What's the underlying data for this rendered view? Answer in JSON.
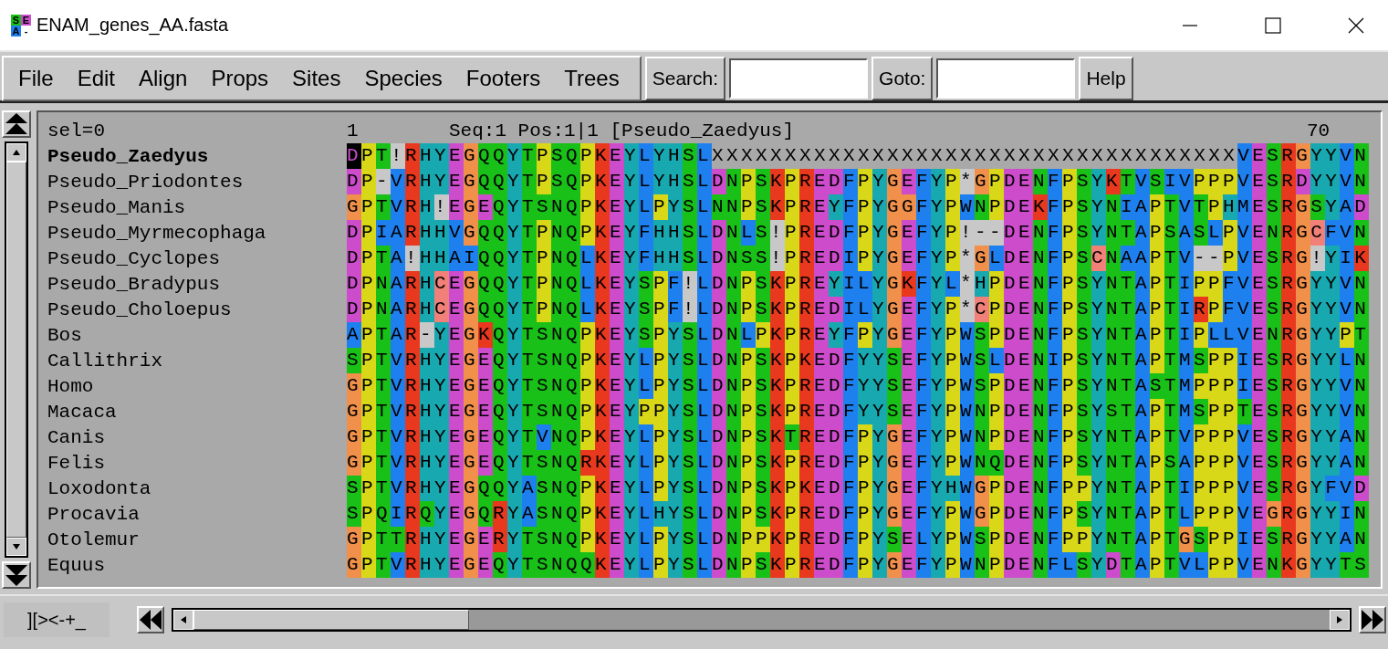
{
  "window": {
    "title": "ENAM_genes_AA.fasta",
    "icon_letters": [
      "S",
      "E",
      "A",
      "-"
    ]
  },
  "menu": [
    "File",
    "Edit",
    "Align",
    "Props",
    "Sites",
    "Species",
    "Footers",
    "Trees"
  ],
  "toolbar": {
    "search_button": "Search:",
    "goto_button": "Goto:",
    "help_button": "Help"
  },
  "alignment": {
    "selection": "sel=0",
    "start": "1",
    "status": "Seq:1 Pos:1|1 [Pseudo_Zaedyus]",
    "end": "70",
    "rows": [
      {
        "name": "Pseudo_Zaedyus",
        "current": true,
        "sequence": "DPT!RHYEGQQYTPSQPKEYLYHSLXXXXXXXXXXXXXXXXXXXXXXXXXXXXXXXXXXXXVESRGYYVN"
      },
      {
        "name": "Pseudo_Priodontes",
        "current": false,
        "sequence": "DP-VRHYEGQQYTPSQPKEYLYHSLDNPSKPREDFPYGEFYP*GPDENFPSYKTVSIVPPPVESRDYYVN"
      },
      {
        "name": "Pseudo_Manis",
        "current": false,
        "sequence": "GPTVRH!EGEQYTSNQPKEYLPYSLNNPSKPREYFPYGGFYPWNPDEKFPSYNIAPTVTPHMESRGSYAD"
      },
      {
        "name": "Pseudo_Myrmecophaga",
        "current": false,
        "sequence": "DPIARHHVGQQYTPNQPKEYFHHSLDNLS!PREDFPYGEFYP!--DENFPSYNTAPSASLPVENRGCFVN"
      },
      {
        "name": "Pseudo_Cyclopes",
        "current": false,
        "sequence": "DPTA!HHAIQQYTPNQLKEYFHHSLDNSS!PREDIPYGEFYP*GLDENFPSCNAAPTV--PVESRG!YIK"
      },
      {
        "name": "Pseudo_Bradypus",
        "current": false,
        "sequence": "DPNARHCEGQQYTPNQLKEYSPF!LDNPSKPREYILYGKFYL*HPDENFPSYNTAPTIPPFVESRGYYVN"
      },
      {
        "name": "Pseudo_Choloepus",
        "current": false,
        "sequence": "DPNARHCEGQQYTPNQLKEYSPF!LDNPSKPREDILYGEFYP*CPDENFPSYNTAPTIRPFVESRGYYVN"
      },
      {
        "name": "Bos",
        "current": false,
        "sequence": "APTAR-YEGKQYTSNQPKEYSPYSLDNLPKPREYFPYGEFYPWSPDENFPSYNTAPTIPLLVENRGYYPT"
      },
      {
        "name": "Callithrix",
        "current": false,
        "sequence": "SPTVRHYEGEQYTSNQPKEYLPYSLDNPSKPKEDFYYSEFYPWSLDENIPSYNTAPTMSPPIESRGYYLN"
      },
      {
        "name": "Homo",
        "current": false,
        "sequence": "GPTVRHYEGEQYTSNQPKEYLPYSLDNPSKPREDFYYSEFYPWSPDENFPSYNTASTMPPPIESRGYYVN"
      },
      {
        "name": "Macaca",
        "current": false,
        "sequence": "GPTVRHYEGEQYTSNQPKEYPPYSLDNPSKPREDFYYSEFYPWNPDENFPSYSTAPTMSPPTESRGYYVN"
      },
      {
        "name": "Canis",
        "current": false,
        "sequence": "GPTVRHYEGEQYTVNQPKEYLPYSLDNPSKTREDFPYGEFYPWNPDENFPSYNTAPTVPPPVESRGYYAN"
      },
      {
        "name": "Felis",
        "current": false,
        "sequence": "GPTVRHYEGEQYTSNQRKEYLPYSLDNPSKPREDFPYGEFYPWNQDENFPSYNTAPSAPPPVESRGYYAN"
      },
      {
        "name": "Loxodonta",
        "current": false,
        "sequence": "SPTVRHYEGQQYASNQPKEYLPYSLDNPSKPKEDFPYGEFYHWGPDENFPPYNTAPTIPPPVESRGYFVD"
      },
      {
        "name": "Procavia",
        "current": false,
        "sequence": "SPQIRQYEGQRYASNQPKEYLHYSLDNPSKPREDFPYGEFYPWGPDENFPSYNTAPTLPPPVEGRGYYIN"
      },
      {
        "name": "Otolemur",
        "current": false,
        "sequence": "GPTTRHYEGERYTSNQPKEYLPYSLDNPPKPREDFPYSELYPWSPDENFPPYNTAPTGSPPIESRGYYAN"
      },
      {
        "name": "Equus",
        "current": false,
        "sequence": "GPTVRHYEGEQYTSNQQKEYLPYSLDNPSKPREDFPYGEFYPWNPDENFLSYDTAPTVLPPVENKGYYTS"
      }
    ]
  },
  "bottom_button": "][><-+_"
}
